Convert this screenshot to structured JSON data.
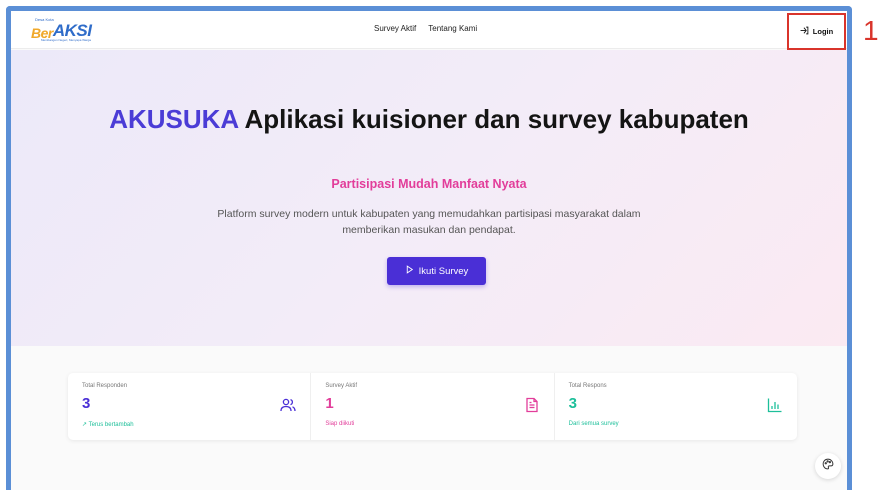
{
  "logo": {
    "tag": "Desa Kota",
    "ber": "Ber",
    "aksi": "AKSI",
    "sub": "Membangun Negeri, Menyapa Warga"
  },
  "nav": {
    "links": [
      "Survey Aktif",
      "Tentang Kami"
    ],
    "login_label": "Login"
  },
  "hero": {
    "brand": "AKUSUKA",
    "title_rest": " Aplikasi kuisioner dan survey kabupaten",
    "subtitle": "Partisipasi Mudah Manfaat Nyata",
    "description": "Platform survey modern untuk kabupaten yang memudahkan partisipasi masyarakat dalam memberikan masukan dan pendapat.",
    "cta_label": "Ikuti Survey"
  },
  "stats": [
    {
      "label": "Total Responden",
      "value": "3",
      "note": "↗ Terus bertambah",
      "color": "#4a2fd6",
      "note_color": "#1dbf9a",
      "icon": "users-icon"
    },
    {
      "label": "Survey Aktif",
      "value": "1",
      "note": "Siap diikuti",
      "color": "#e23d9a",
      "note_color": "#e23d9a",
      "icon": "document-icon"
    },
    {
      "label": "Total Respons",
      "value": "3",
      "note": "Dari semua survey",
      "color": "#1dbf9a",
      "note_color": "#1dbf9a",
      "icon": "bar-chart-icon"
    }
  ],
  "annotation": {
    "step": "1"
  },
  "colors": {
    "accent": "#4a2fd6",
    "pink": "#e23d9a",
    "teal": "#1dbf9a",
    "highlight": "#d9342b",
    "frame": "#5b8fd6"
  }
}
